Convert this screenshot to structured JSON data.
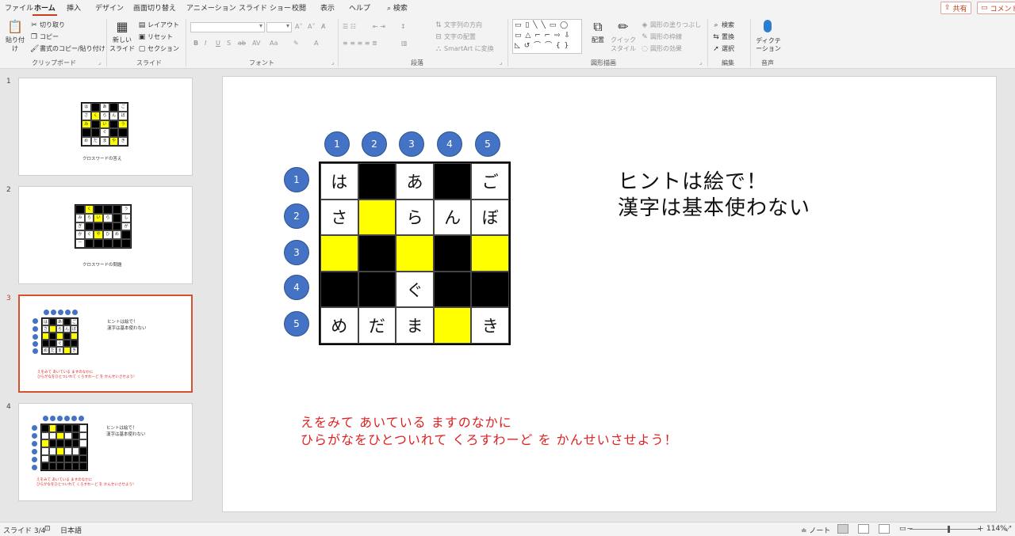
{
  "tabs": {
    "items": [
      "ファイル",
      "ホーム",
      "挿入",
      "デザイン",
      "画面切り替え",
      "アニメーション",
      "スライド ショー",
      "校閲",
      "表示",
      "ヘルプ"
    ],
    "search": "検索",
    "share": "共有",
    "comment": "コメント"
  },
  "ribbon": {
    "clipboard": {
      "paste": "貼り付け",
      "cut": "切り取り",
      "copy": "コピー",
      "format_painter": "書式のコピー/貼り付け",
      "label": "クリップボード"
    },
    "slides": {
      "new_slide": "新しい スライド",
      "layout": "レイアウト",
      "reset": "リセット",
      "section": "セクション",
      "label": "スライド"
    },
    "font": {
      "label": "フォント",
      "bold": "B",
      "italic": "I",
      "underline": "U",
      "strike": "S",
      "ab": "ab",
      "av": "AV",
      "aa": "Aa"
    },
    "paragraph": {
      "label": "段落",
      "text_direction": "文字列の方向",
      "align_text": "文字の配置",
      "smartart": "SmartArt に変換"
    },
    "drawing": {
      "label": "図形描画",
      "arrange": "配置",
      "quick_styles": "クイック スタイル",
      "shape_fill": "図形の塗りつぶし",
      "shape_outline": "図形の枠線",
      "shape_effects": "図形の効果"
    },
    "editing": {
      "label": "編集",
      "find": "検索",
      "replace": "置換",
      "select": "選択"
    },
    "voice": {
      "label": "音声",
      "dictate": "ディクテーション"
    }
  },
  "thumbnails": [
    {
      "num": "1",
      "caption": "クロスワードの答え"
    },
    {
      "num": "2",
      "caption": "クロスワードの問題"
    },
    {
      "num": "3",
      "hint1": "ヒントは絵で！",
      "hint2": "漢字は基本使わない",
      "red1": "えをみて あいている ますのなかに",
      "red2": "ひらがなをひとついれて くろすわーど を かんせいさせよう！"
    },
    {
      "num": "4",
      "hint1": "ヒントは絵で！",
      "hint2": "漢字は基本使わない",
      "red1": "えをみて あいている ますのなかに",
      "red2": "ひらがなをひとついれて くろすわーど を かんせいさせよう！"
    }
  ],
  "slide": {
    "col_numbers": [
      "1",
      "2",
      "3",
      "4",
      "5"
    ],
    "row_numbers": [
      "1",
      "2",
      "3",
      "4",
      "5"
    ],
    "grid": [
      [
        {
          "t": "は",
          "c": "white"
        },
        {
          "t": "",
          "c": "black"
        },
        {
          "t": "あ",
          "c": "white"
        },
        {
          "t": "",
          "c": "black"
        },
        {
          "t": "ご",
          "c": "white"
        }
      ],
      [
        {
          "t": "さ",
          "c": "white"
        },
        {
          "t": "",
          "c": "yellow"
        },
        {
          "t": "ら",
          "c": "white"
        },
        {
          "t": "ん",
          "c": "white"
        },
        {
          "t": "ぼ",
          "c": "white"
        }
      ],
      [
        {
          "t": "",
          "c": "yellow"
        },
        {
          "t": "",
          "c": "black"
        },
        {
          "t": "",
          "c": "yellow"
        },
        {
          "t": "",
          "c": "black"
        },
        {
          "t": "",
          "c": "yellow"
        }
      ],
      [
        {
          "t": "",
          "c": "black"
        },
        {
          "t": "",
          "c": "black"
        },
        {
          "t": "ぐ",
          "c": "white"
        },
        {
          "t": "",
          "c": "black"
        },
        {
          "t": "",
          "c": "black"
        }
      ],
      [
        {
          "t": "め",
          "c": "white"
        },
        {
          "t": "だ",
          "c": "white"
        },
        {
          "t": "ま",
          "c": "white"
        },
        {
          "t": "",
          "c": "yellow"
        },
        {
          "t": "き",
          "c": "white"
        }
      ]
    ],
    "hint_line1": "ヒントは絵で！",
    "hint_line2": "漢字は基本使わない",
    "instruction_line1": "えをみて あいている ますのなかに",
    "instruction_line2": "ひらがなをひとついれて くろすわーど を かんせいさせよう！"
  },
  "status": {
    "slide": "スライド 3/4",
    "language": "日本語",
    "notes": "ノート",
    "zoom": "114%",
    "minus": "－",
    "plus": "＋"
  },
  "colors": {
    "accent": "#c43e1c",
    "circle": "#4472c4",
    "yellow": "#ffff00",
    "red_text": "#e02020"
  }
}
